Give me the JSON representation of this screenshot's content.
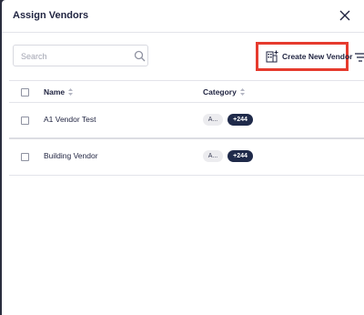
{
  "dialog": {
    "title": "Assign Vendors"
  },
  "toolbar": {
    "search_placeholder": "Search",
    "search_value": "",
    "create_button_label": "Create New Vendor"
  },
  "table": {
    "headers": {
      "name": "Name",
      "category": "Category"
    },
    "rows": [
      {
        "name": "A1 Vendor Test",
        "category_chip": "A...",
        "more_chip": "+244"
      },
      {
        "name": "Building Vendor",
        "category_chip": "A...",
        "more_chip": "+244"
      }
    ]
  },
  "colors": {
    "highlight_border": "#e63b2e",
    "primary_text": "#1f2340",
    "more_chip_bg": "#1f2a4a",
    "category_chip_bg": "#ececef"
  },
  "icons": {
    "close": "close-icon",
    "search": "search-icon",
    "create": "building-add-icon",
    "filter": "filter-icon",
    "sort": "sort-icon"
  }
}
